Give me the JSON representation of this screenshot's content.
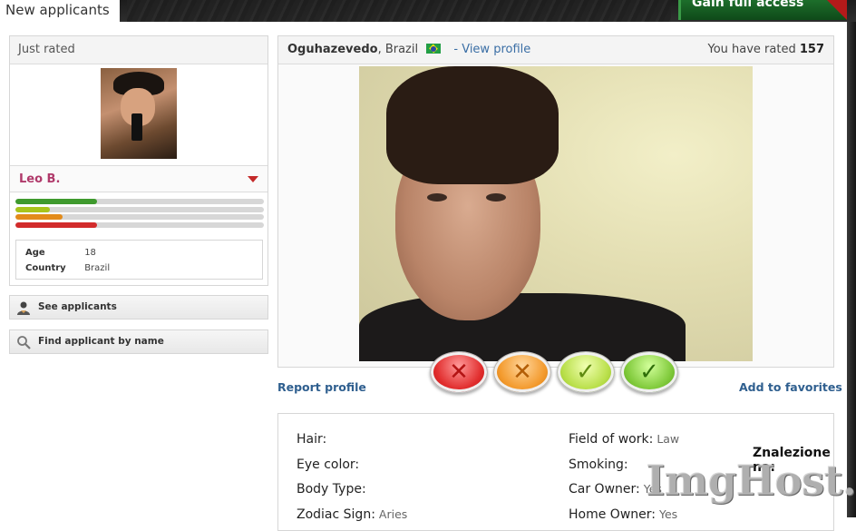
{
  "header": {
    "tab_label": "New applicants",
    "full_access_label": "Gain full access"
  },
  "just_rated": {
    "title": "Just rated",
    "name": "Leo B.",
    "bars": [
      {
        "fraction": 0.33,
        "color": "#3f9a2e"
      },
      {
        "fraction": 0.14,
        "color": "#a9c41c"
      },
      {
        "fraction": 0.19,
        "color": "#e38b1a"
      },
      {
        "fraction": 0.33,
        "color": "#d22b2b"
      }
    ],
    "info": [
      {
        "key": "Age",
        "value": "18"
      },
      {
        "key": "Country",
        "value": "Brazil"
      }
    ]
  },
  "sidebar": {
    "see_applicants": "See applicants",
    "find_by_name": "Find applicant by name"
  },
  "profile": {
    "username": "Oguhazevedo",
    "country": ", Brazil",
    "view_profile": "- View profile",
    "rated_label": "You have rated",
    "rated_count": "157",
    "report": "Report profile",
    "favorites": "Add to favorites"
  },
  "rating_buttons": [
    {
      "name": "rate-no-button",
      "symbol": "✕",
      "color": "#b31414"
    },
    {
      "name": "rate-maybe-no-button",
      "symbol": "✕",
      "color": "#b35e07"
    },
    {
      "name": "rate-maybe-yes-button",
      "symbol": "✓",
      "color": "#5f8a10"
    },
    {
      "name": "rate-yes-button",
      "symbol": "✓",
      "color": "#2f6e0a"
    }
  ],
  "details": {
    "left": [
      {
        "key": "Hair:",
        "value": ""
      },
      {
        "key": "Eye color:",
        "value": ""
      },
      {
        "key": "Body Type:",
        "value": ""
      },
      {
        "key": "Zodiac Sign:",
        "value": "Aries"
      }
    ],
    "right": [
      {
        "key": "Field of work:",
        "value": "Law"
      },
      {
        "key": "Smoking:",
        "value": ""
      },
      {
        "key": "Car Owner:",
        "value": "Yes"
      },
      {
        "key": "Home Owner:",
        "value": "Yes"
      }
    ]
  },
  "watermark": {
    "top": "Znalezione na:",
    "brand": "ImgHost.pl"
  }
}
